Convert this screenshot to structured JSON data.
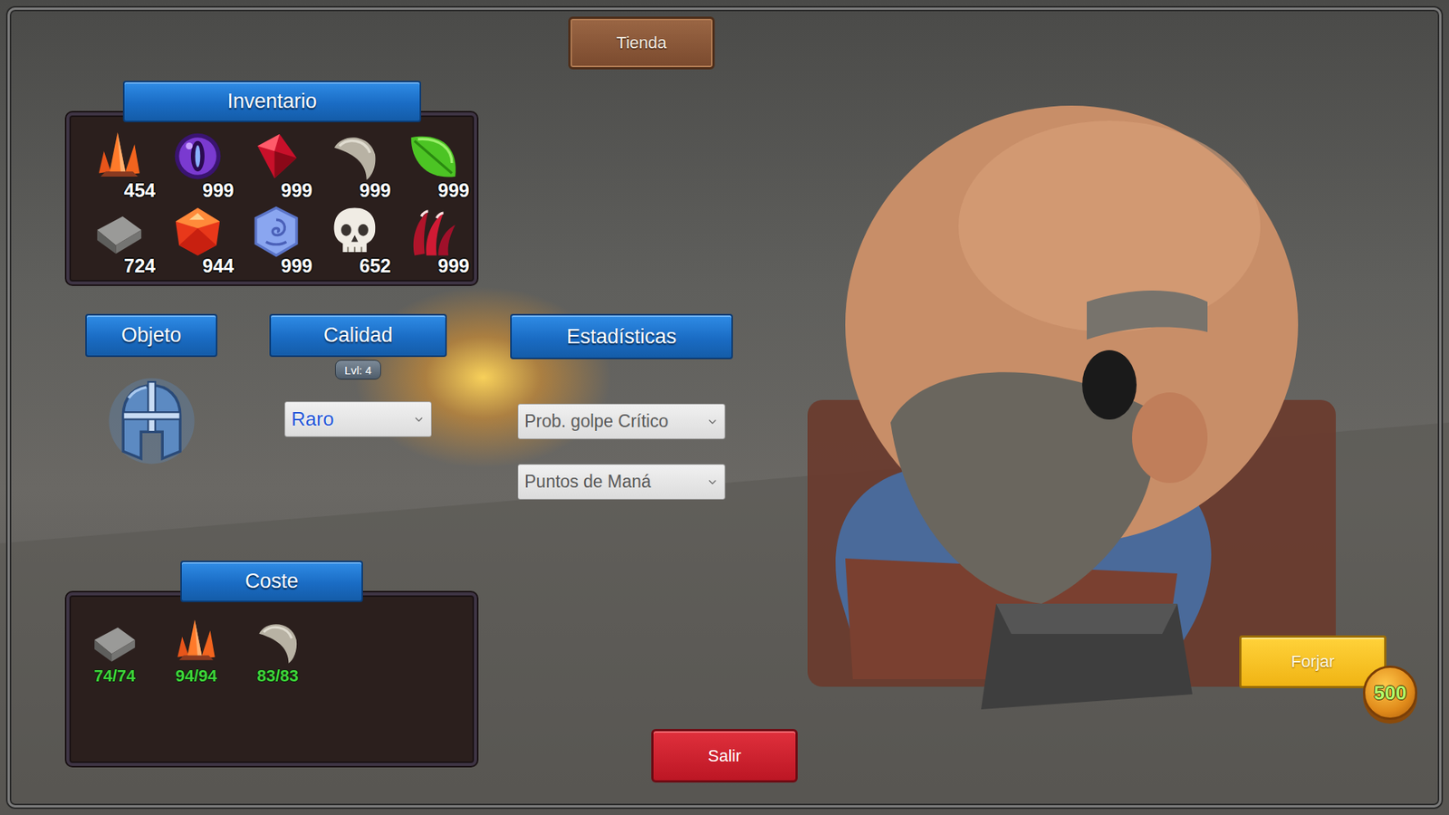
{
  "shop_button": "Tienda",
  "inventory": {
    "title": "Inventario",
    "items": [
      {
        "kind": "crystal",
        "count": "454"
      },
      {
        "kind": "eye",
        "count": "999"
      },
      {
        "kind": "ruby",
        "count": "999"
      },
      {
        "kind": "fang",
        "count": "999"
      },
      {
        "kind": "leaf",
        "count": "999"
      },
      {
        "kind": "ingot",
        "count": "724"
      },
      {
        "kind": "gem",
        "count": "944"
      },
      {
        "kind": "rune",
        "count": "999"
      },
      {
        "kind": "skull",
        "count": "652"
      },
      {
        "kind": "claw",
        "count": "999"
      }
    ]
  },
  "object": {
    "title": "Objeto"
  },
  "quality": {
    "title": "Calidad",
    "level_badge": "Lvl: 4",
    "value": "Raro"
  },
  "stats": {
    "title": "Estadísticas",
    "values": [
      "Prob. golpe Crítico",
      "Puntos de Maná"
    ]
  },
  "cost": {
    "title": "Coste",
    "items": [
      {
        "kind": "ingot",
        "amount": "74/74",
        "enough": true
      },
      {
        "kind": "crystal",
        "amount": "94/94",
        "enough": true
      },
      {
        "kind": "fang",
        "amount": "83/83",
        "enough": true
      }
    ]
  },
  "forge_button": {
    "label": "Forjar",
    "price": "500"
  },
  "exit_button": "Salir"
}
